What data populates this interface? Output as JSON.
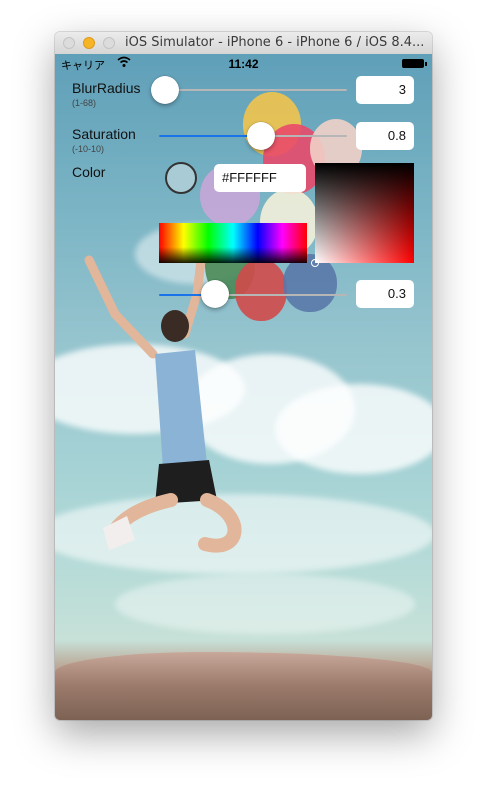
{
  "window": {
    "title": "iOS Simulator - iPhone 6 - iPhone 6 / iOS 8.4..."
  },
  "statusbar": {
    "carrier": "キャリア",
    "wifi_icon": "wifi-icon",
    "time": "11:42",
    "battery_icon": "battery-icon"
  },
  "controls": {
    "blur": {
      "label": "BlurRadius",
      "range": "(1-68)",
      "value": "3",
      "fraction": 0.03
    },
    "saturation": {
      "label": "Saturation",
      "range": "(-10-10)",
      "value": "0.8",
      "fraction": 0.54
    },
    "color": {
      "label": "Color",
      "hex": "#FFFFFF"
    },
    "alpha": {
      "value": "0.3",
      "fraction": 0.3
    }
  },
  "colors": {
    "accent": "#1a73e8",
    "swatch": "#a9cbd6"
  }
}
